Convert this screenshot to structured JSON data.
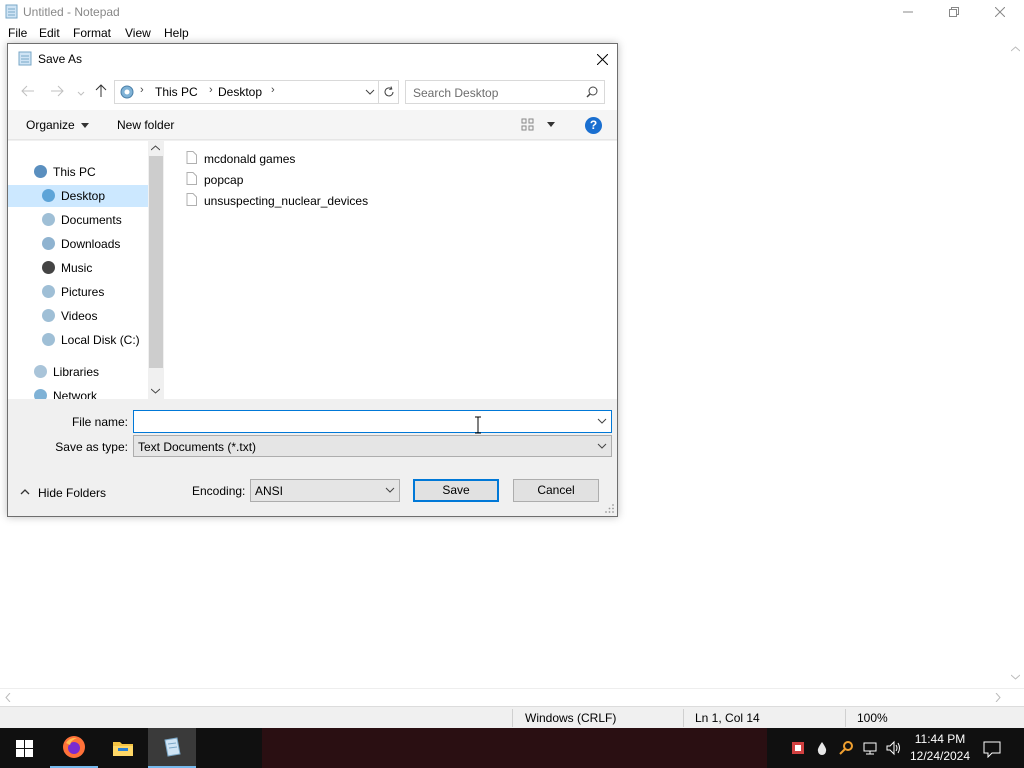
{
  "notepad": {
    "title": "Untitled - Notepad",
    "menu": [
      "File",
      "Edit",
      "Format",
      "View",
      "Help"
    ],
    "status": {
      "line_ending": "Windows (CRLF)",
      "position": "Ln 1, Col 14",
      "zoom": "100%"
    }
  },
  "dialog": {
    "title": "Save As",
    "breadcrumb": [
      "This PC",
      "Desktop"
    ],
    "search_placeholder": "Search Desktop",
    "organize_label": "Organize",
    "new_folder_label": "New folder",
    "tree": [
      {
        "label": "This PC",
        "icon": "computer-icon",
        "level": 0
      },
      {
        "label": "Desktop",
        "icon": "desktop-icon",
        "level": 1,
        "selected": true
      },
      {
        "label": "Documents",
        "icon": "documents-icon",
        "level": 1
      },
      {
        "label": "Downloads",
        "icon": "downloads-icon",
        "level": 1
      },
      {
        "label": "Music",
        "icon": "music-icon",
        "level": 1
      },
      {
        "label": "Pictures",
        "icon": "pictures-icon",
        "level": 1
      },
      {
        "label": "Videos",
        "icon": "videos-icon",
        "level": 1
      },
      {
        "label": "Local Disk (C:)",
        "icon": "disk-icon",
        "level": 1
      },
      {
        "label": "Libraries",
        "icon": "libraries-icon",
        "level": 0
      },
      {
        "label": "Network",
        "icon": "network-icon",
        "level": 0
      }
    ],
    "files": [
      "mcdonald games",
      "popcap",
      "unsuspecting_nuclear_devices"
    ],
    "file_name_label": "File name:",
    "file_name_value": "",
    "save_type_label": "Save as type:",
    "save_type_value": "Text Documents (*.txt)",
    "hide_folders_label": "Hide Folders",
    "encoding_label": "Encoding:",
    "encoding_value": "ANSI",
    "save_label": "Save",
    "cancel_label": "Cancel"
  },
  "taskbar": {
    "time": "11:44 PM",
    "date": "12/24/2024"
  },
  "colors": {
    "accent": "#0078d7",
    "selection": "#cce8ff",
    "taskbar": "#101010"
  }
}
